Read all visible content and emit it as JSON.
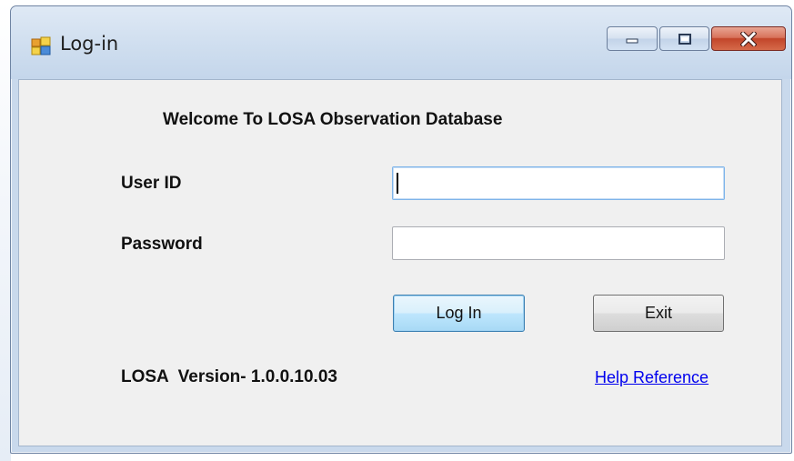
{
  "window": {
    "title": "Log-in",
    "icon": "app-window-icon",
    "controls": {
      "minimize_icon": "minimize-icon",
      "maximize_icon": "maximize-icon",
      "close_icon": "close-icon"
    }
  },
  "form": {
    "welcome": "Welcome To LOSA Observation Database",
    "user_id_label": "User ID",
    "user_id_value": "",
    "password_label": "Password",
    "password_value": "",
    "login_button": "Log In",
    "exit_button": "Exit",
    "version_text": "LOSA  Version- 1.0.0.10.03",
    "help_link": "Help Reference"
  },
  "colors": {
    "link": "#0000ee",
    "client_bg": "#f0f0f0",
    "close_button": "#c2452a"
  }
}
